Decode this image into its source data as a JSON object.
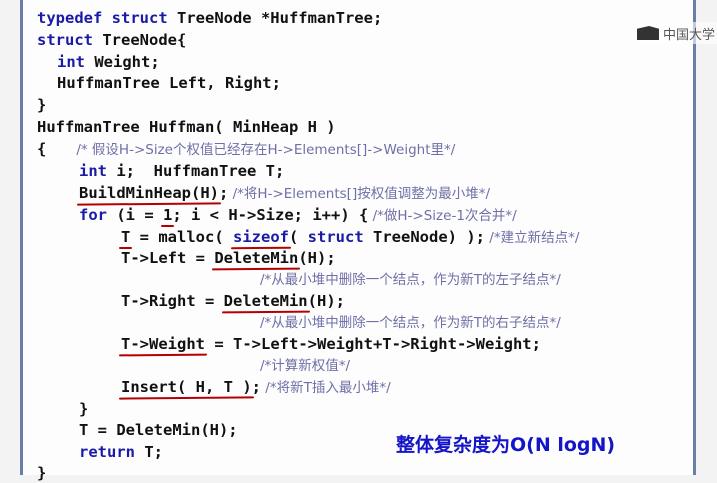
{
  "watermark": {
    "text": "中国大学",
    "icon": "mooc-logo-icon"
  },
  "code": {
    "l1": {
      "kw": "typedef struct",
      "rest": " TreeNode *HuffmanTree;"
    },
    "l2": {
      "kw": "struct",
      "rest": " TreeNode{"
    },
    "l3": {
      "kw": "int",
      "rest": " Weight;"
    },
    "l4": {
      "rest": "HuffmanTree Left, Right;"
    },
    "l5": {
      "rest": "}"
    },
    "l6": {
      "rest": "HuffmanTree Huffman( MinHeap H )"
    },
    "l7": {
      "rest": "{",
      "comment": "/* 假设H->Size个权值已经存在H->Elements[]->Weight里*/"
    },
    "l8": {
      "kw": "int",
      "rest": " i;  HuffmanTree T;"
    },
    "l9": {
      "call": "BuildMinHeap(H)",
      "rest": ";",
      "comment": " /*将H->Elements[]按权值调整为最小堆*/"
    },
    "l10": {
      "kw": "for",
      "rest_a": " (i = ",
      "one": "1",
      "rest_b": "; i < H->Size; i++) {",
      "comment": " /*做H->Size-1次合并*/"
    },
    "l11": {
      "t": "T",
      "rest_a": " = malloc( ",
      "sizeof": "sizeof",
      "rest_b": "( ",
      "kw2": "struct",
      "rest_c": " TreeNode) );",
      "comment": " /*建立新结点*/"
    },
    "l12": {
      "rest": "T->Left = ",
      "call": "DeleteMin",
      "rest_b": "(H);"
    },
    "l13": {
      "comment": "/*从最小堆中删除一个结点，作为新T的左子结点*/"
    },
    "l14": {
      "rest": "T->Right = ",
      "call": "DeleteMin",
      "rest_b": "(H);"
    },
    "l15": {
      "comment": "/*从最小堆中删除一个结点，作为新T的右子结点*/"
    },
    "l16": {
      "lhs": "T->Weight",
      "rest": " = T->Left->Weight+T->Right->Weight;"
    },
    "l17": {
      "comment": "/*计算新权值*/"
    },
    "l18": {
      "call": "Insert( H, T )",
      "rest": ";",
      "comment": " /*将新T插入最小堆*/"
    },
    "l19": {
      "rest": "}"
    },
    "l20": {
      "rest": "T = DeleteMin(H);"
    },
    "l21": {
      "kw": "return",
      "rest": " T;"
    },
    "l22": {
      "rest": "}"
    }
  },
  "complexity_note": "整体复杂度为O(N logN)"
}
